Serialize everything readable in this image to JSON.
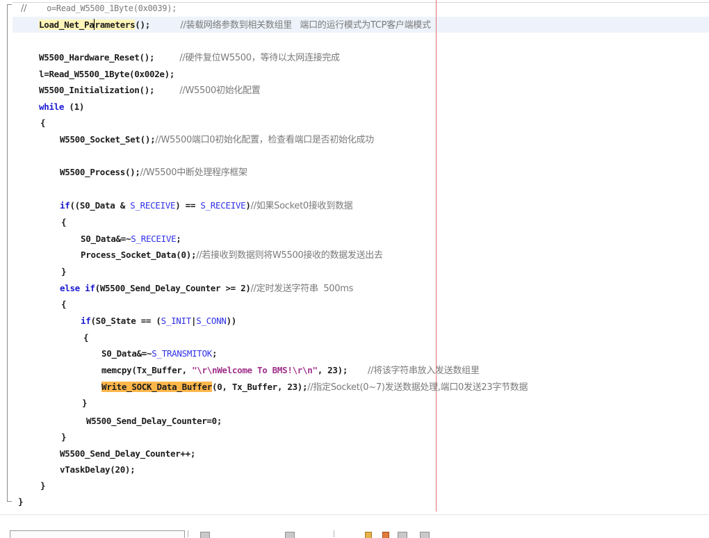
{
  "editor": {
    "lines": {
      "l01": {
        "prefix": "//",
        "code": "o=Read_W5500_1Byte(0x0039);"
      },
      "l02": {
        "fn": "Load_Net_Pa",
        "fn2": "rameters",
        "rest": "();",
        "comment": "//装载网络参数到相关数组里   端口的运行模式为TCP客户端模式"
      },
      "l03": {
        "fn": "W5500_Hardware_Reset",
        "rest": "();",
        "comment": "//硬件复位W5500，等待以太网连接完成"
      },
      "l04": {
        "code": "l=Read_W5500_1Byte(0x002e);"
      },
      "l05": {
        "fn": "W5500_Initialization",
        "rest": "();",
        "comment": "//W5500初始化配置"
      },
      "l06": {
        "kw": "while",
        "rest": " (1)"
      },
      "l07": {
        "code": "{"
      },
      "l08": {
        "fn": "W5500_Socket_Set",
        "rest": "();",
        "comment": "//W5500端口0初始化配置，检查看端口是否初始化成功"
      },
      "l09": {
        "fn": "W5500_Process",
        "rest": "();",
        "comment": "//W5500中断处理程序框架"
      },
      "l10": {
        "kw": "if",
        "a": "((S0_Data & ",
        "mac1": "S_RECEIVE",
        "b": ") == ",
        "mac2": "S_RECEIVE",
        "c": ")",
        "comment": "//如果Socket0接收到数据"
      },
      "l11": {
        "code": "{"
      },
      "l12": {
        "a": "S0_Data&=~",
        "mac": "S_RECEIVE",
        "b": ";"
      },
      "l13": {
        "fn": "Process_Socket_Data",
        "rest": "(0);",
        "comment": "//若接收到数据则将W5500接收的数据发送出去"
      },
      "l14": {
        "code": "}"
      },
      "l15": {
        "kw": "else if",
        "a": "(W5500_Send_Delay_Counter >= 2)",
        "comment": "//定时发送字符串  500ms"
      },
      "l16": {
        "code": "{"
      },
      "l17": {
        "kw": "if",
        "a": "(S0_State == (",
        "mac1": "S_INIT",
        "sep": "|",
        "mac2": "S_CONN",
        "b": "))"
      },
      "l18": {
        "code": "{"
      },
      "l19": {
        "a": "S0_Data&=~",
        "mac": "S_TRANSMITOK",
        "b": ";"
      },
      "l20": {
        "a": "memcpy(Tx_Buffer, ",
        "str": "\"\\r\\nWelcome To BMS!\\r\\n\"",
        "b": ", 23);",
        "comment": "//将该字符串放入发送数组里"
      },
      "l21": {
        "fn": "Write_SOCK_Data_Buffer",
        "rest": "(0, Tx_Buffer, 23);",
        "comment": "//指定Socket(0~7)发送数据处理,端口0发送23字节数据"
      },
      "l22": {
        "code": "}"
      },
      "l23": {
        "code": "W5500_Send_Delay_Counter=0;"
      },
      "l24": {
        "code": "}"
      },
      "l25": {
        "code": "W5500_Send_Delay_Counter++;"
      },
      "l26": {
        "code": "vTaskDelay(20);"
      },
      "l27": {
        "code": "}"
      },
      "l28": {
        "code": "}"
      }
    }
  },
  "colors": {
    "keyword": "#1a1ad2",
    "comment": "#7a7a7a",
    "macro": "#3030e8",
    "string": "#a0308a",
    "highlight_yellow": "#fff5b8",
    "highlight_orange": "#ffb74a",
    "edge_guide": "#e07070"
  }
}
